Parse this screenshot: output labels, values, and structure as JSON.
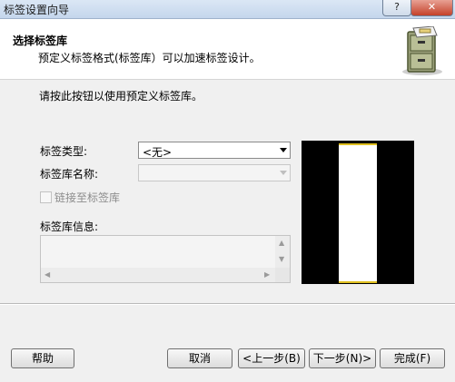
{
  "window": {
    "title": "标签设置向导",
    "help_glyph": "?",
    "close_glyph": "✕"
  },
  "header": {
    "title": "选择标签库",
    "subtitle": "预定义标签格式(标签库）可以加速标签设计。",
    "icon": "file-cabinet-icon"
  },
  "instruction": "请按此按钮以使用预定义标签库。",
  "form": {
    "label_type_label": "标签类型:",
    "label_type_value": "<无>",
    "library_name_label": "标签库名称:",
    "library_name_value": "",
    "link_checkbox_label": "链接至标签库",
    "link_checked": false,
    "info_label": "标签库信息:"
  },
  "buttons": {
    "help": "帮助",
    "cancel": "取消",
    "back": "<上一步(B)",
    "next": "下一步(N)>",
    "finish": "完成(F)"
  },
  "colors": {
    "preview_bg": "#000000",
    "label_edge": "#e0c020"
  }
}
